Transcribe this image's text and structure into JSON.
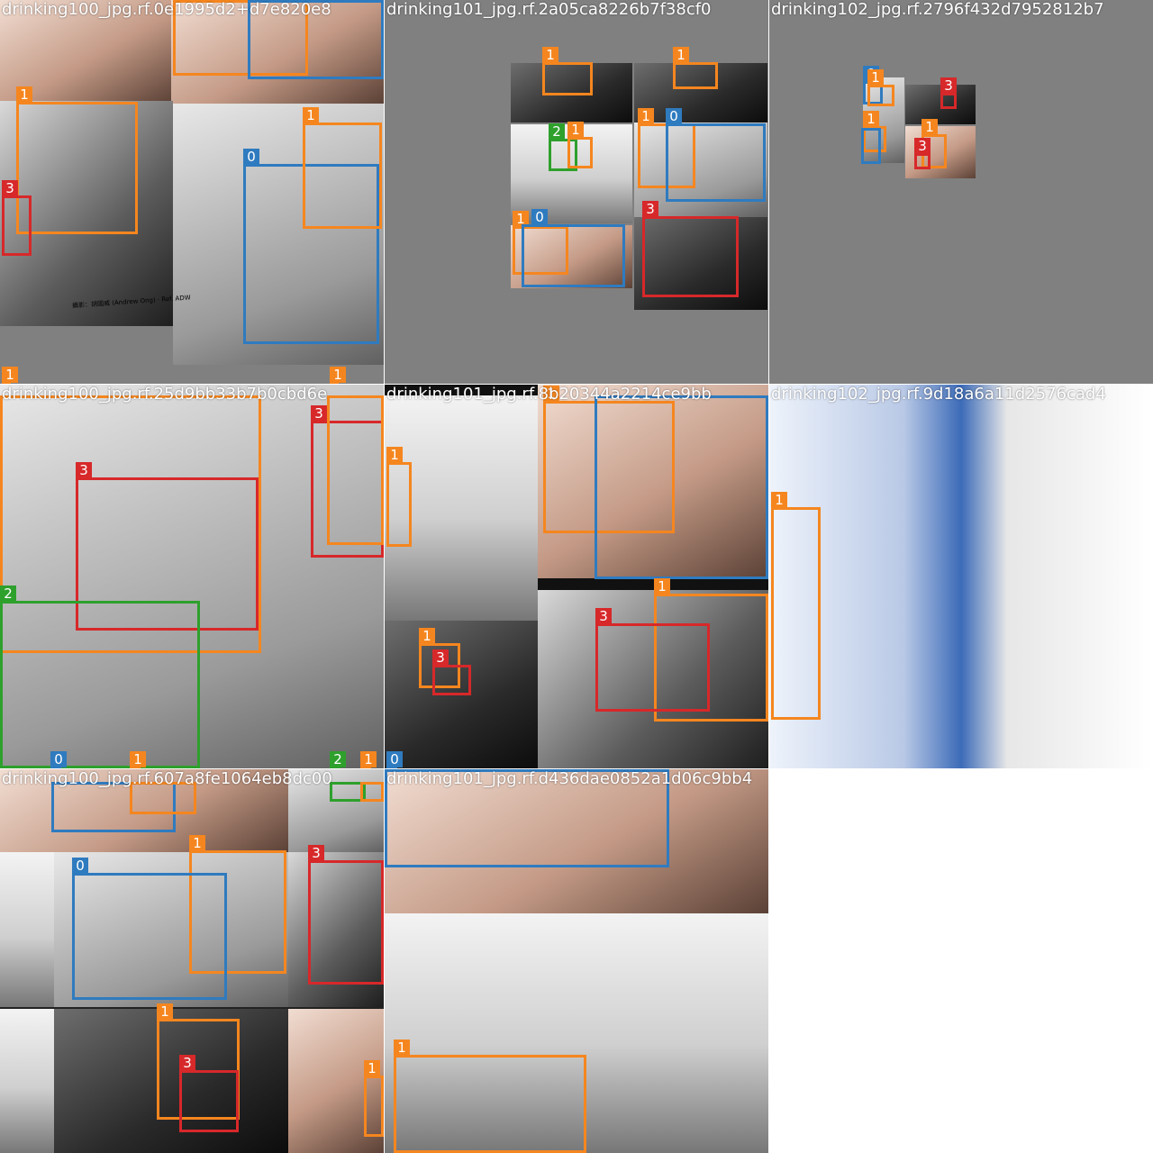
{
  "tiles": [
    {
      "name": "drinking100_jpg.rf.0e1995d2+d7e820e8"
    },
    {
      "name": "drinking101_jpg.rf.2a05ca8226b7f38cf0"
    },
    {
      "name": "drinking102_jpg.rf.2796f432d7952812b7"
    },
    {
      "name": "drinking100_jpg.rf.25d9bb33b7b0cbd6e"
    },
    {
      "name": "drinking101_jpg.rf.8b20344a2214ce9bb"
    },
    {
      "name": "drinking102_jpg.rf.9d18a6a11d2576cad4"
    },
    {
      "name": "drinking100_jpg.rf.607a8fe1064eb8dc00"
    },
    {
      "name": "drinking101_jpg.rf.d436dae0852a1d06c9bb4"
    }
  ],
  "photo_caption": "攝影：胡國威 (Andrew Ong) · Ref. ADW",
  "class_colors": {
    "0": "#2f7bbf",
    "1": "#f5861f",
    "2": "#2ea02c",
    "3": "#d7282a"
  },
  "box_labels": {
    "c0": "0",
    "c1": "1",
    "c2": "2",
    "c3": "3"
  }
}
